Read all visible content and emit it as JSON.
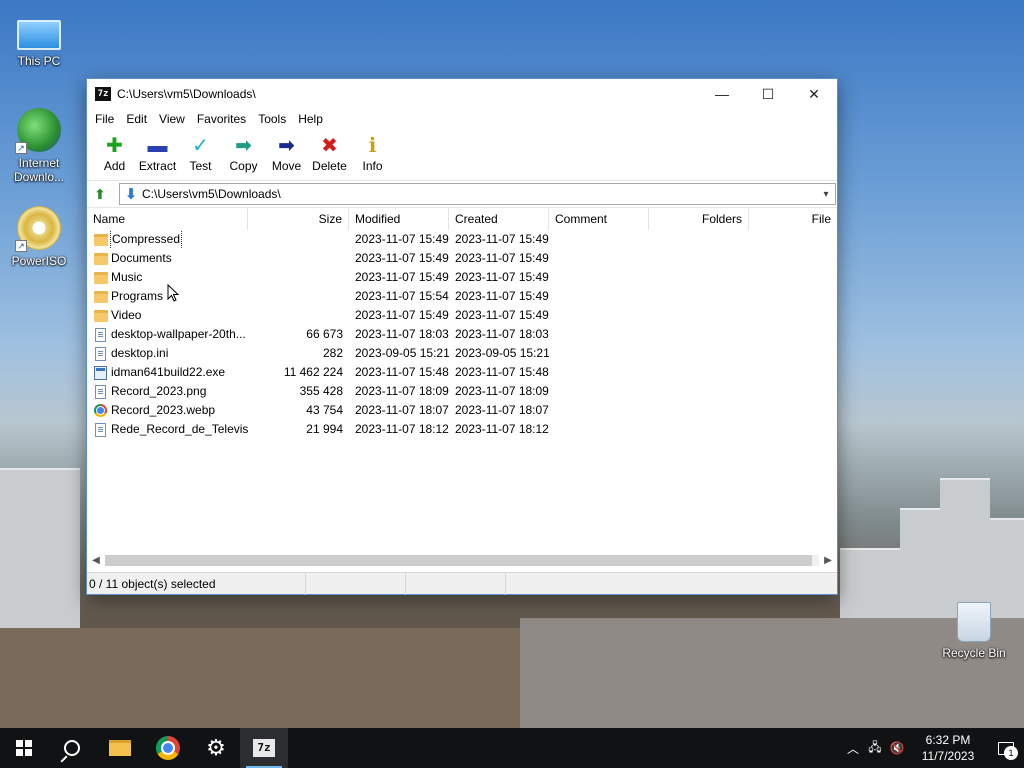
{
  "desktop": {
    "icons": [
      {
        "label": "This PC",
        "icon": "computer-icon"
      },
      {
        "label": "Internet Downlo...",
        "icon": "idm-icon"
      },
      {
        "label": "PowerISO",
        "icon": "poweriso-icon"
      },
      {
        "label": "Recycle Bin",
        "icon": "recycle-bin-icon"
      }
    ]
  },
  "window": {
    "title": "C:\\Users\\vm5\\Downloads\\",
    "app_icon_text": "7z",
    "controls": {
      "minimize": "—",
      "maximize": "☐",
      "close": "✕"
    },
    "menu": [
      "File",
      "Edit",
      "View",
      "Favorites",
      "Tools",
      "Help"
    ],
    "toolbar": [
      {
        "label": "Add",
        "icon": "plus-icon",
        "color": "#1aa31a",
        "glyph": "✚"
      },
      {
        "label": "Extract",
        "icon": "minus-icon",
        "color": "#2a3fb0",
        "glyph": "▬"
      },
      {
        "label": "Test",
        "icon": "check-icon",
        "color": "#1ab3c6",
        "glyph": "✓"
      },
      {
        "label": "Copy",
        "icon": "copy-arrow-icon",
        "color": "#1e9a86",
        "glyph": "➡"
      },
      {
        "label": "Move",
        "icon": "move-arrow-icon",
        "color": "#1c2a8c",
        "glyph": "➡"
      },
      {
        "label": "Delete",
        "icon": "delete-x-icon",
        "color": "#d21e1e",
        "glyph": "✖"
      },
      {
        "label": "Info",
        "icon": "info-icon",
        "color": "#c9a400",
        "glyph": "ℹ"
      }
    ],
    "address": "C:\\Users\\vm5\\Downloads\\",
    "columns": [
      "Name",
      "Size",
      "Modified",
      "Created",
      "Comment",
      "Folders",
      "File"
    ],
    "files": [
      {
        "name": "Compressed",
        "type": "folder",
        "size": "",
        "modified": "2023-11-07 15:49",
        "created": "2023-11-07 15:49"
      },
      {
        "name": "Documents",
        "type": "folder",
        "size": "",
        "modified": "2023-11-07 15:49",
        "created": "2023-11-07 15:49"
      },
      {
        "name": "Music",
        "type": "folder",
        "size": "",
        "modified": "2023-11-07 15:49",
        "created": "2023-11-07 15:49"
      },
      {
        "name": "Programs",
        "type": "folder",
        "size": "",
        "modified": "2023-11-07 15:54",
        "created": "2023-11-07 15:49"
      },
      {
        "name": "Video",
        "type": "folder",
        "size": "",
        "modified": "2023-11-07 15:49",
        "created": "2023-11-07 15:49"
      },
      {
        "name": "desktop-wallpaper-20th...",
        "type": "file",
        "size": "66 673",
        "modified": "2023-11-07 18:03",
        "created": "2023-11-07 18:03"
      },
      {
        "name": "desktop.ini",
        "type": "file",
        "size": "282",
        "modified": "2023-09-05 15:21",
        "created": "2023-09-05 15:21"
      },
      {
        "name": "idman641build22.exe",
        "type": "exe",
        "size": "11 462 224",
        "modified": "2023-11-07 15:48",
        "created": "2023-11-07 15:48"
      },
      {
        "name": "Record_2023.png",
        "type": "file",
        "size": "355 428",
        "modified": "2023-11-07 18:09",
        "created": "2023-11-07 18:09"
      },
      {
        "name": "Record_2023.webp",
        "type": "chrome",
        "size": "43 754",
        "modified": "2023-11-07 18:07",
        "created": "2023-11-07 18:07"
      },
      {
        "name": "Rede_Record_de_Televis...",
        "type": "file",
        "size": "21 994",
        "modified": "2023-11-07 18:12",
        "created": "2023-11-07 18:12"
      }
    ],
    "status": "0 / 11 object(s) selected"
  },
  "taskbar": {
    "items": [
      "start",
      "search",
      "file-explorer",
      "chrome",
      "settings",
      "7zip"
    ],
    "active": "7zip",
    "time": "6:32 PM",
    "date": "11/7/2023",
    "notification_count": "1"
  }
}
